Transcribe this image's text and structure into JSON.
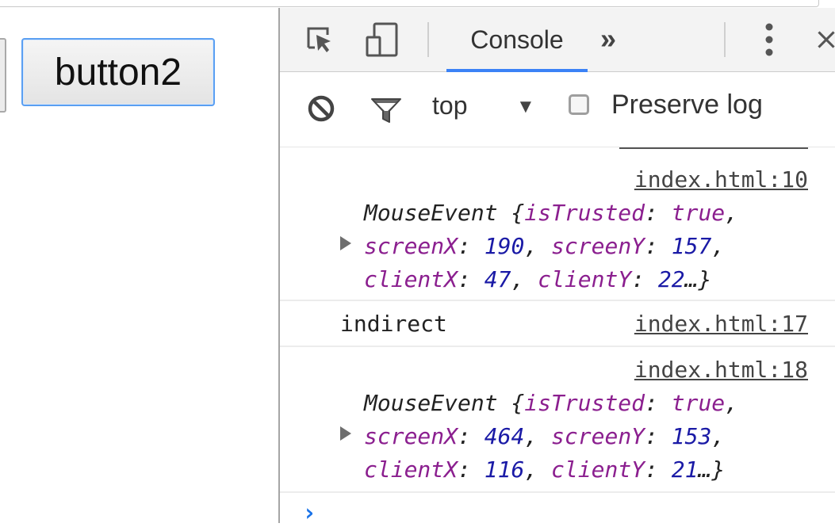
{
  "page": {
    "button2_label": "button2"
  },
  "devtools": {
    "tabs": {
      "console": "Console",
      "more": "»"
    },
    "toolbar": {
      "context": "top",
      "context_arrow": "▼",
      "preserve_log": "Preserve log",
      "preserve_log_checked": false
    },
    "messages": [
      {
        "source": "index.html:10",
        "object": {
          "type": "MouseEvent",
          "isTrusted": "true",
          "screenX": "190",
          "screenY": "157",
          "clientX": "47",
          "clientY": "22"
        }
      },
      {
        "text": "indirect",
        "source": "index.html:17"
      },
      {
        "source": "index.html:18",
        "object": {
          "type": "MouseEvent",
          "isTrusted": "true",
          "screenX": "464",
          "screenY": "153",
          "clientX": "116",
          "clientY": "21"
        }
      }
    ],
    "prompt": "›",
    "icons": [
      "inspect-element-icon",
      "device-toolbar-icon",
      "kebab-menu-icon",
      "close-icon",
      "clear-console-icon",
      "filter-icon",
      "expand-triangle-icon"
    ],
    "accent_color": "#3b82f6"
  }
}
